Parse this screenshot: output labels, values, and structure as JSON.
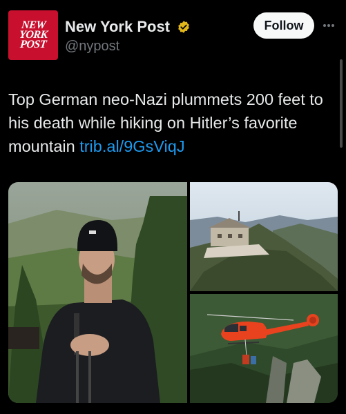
{
  "account": {
    "logo_lines": [
      "NEW",
      "YORK",
      "POST"
    ],
    "name": "New York Post",
    "handle": "@nypost",
    "verified": true,
    "verified_badge_color": "#e2b719"
  },
  "actions": {
    "follow_label": "Follow",
    "more_icon": "ellipsis-icon"
  },
  "tweet": {
    "text": "Top German neo-Nazi plummets 200 feet to his death while hiking on Hitler’s favorite mountain ",
    "link": "trib.al/9GsViqJ"
  },
  "media": {
    "photos": [
      "hiker-portrait-photo",
      "mountain-top-building-photo",
      "rescue-helicopter-photo"
    ]
  },
  "colors": {
    "background": "#000000",
    "text": "#e7e9ea",
    "secondary_text": "#71767b",
    "link": "#1d9bf0",
    "brand_red": "#c8102e",
    "helicopter": "#e8431e"
  }
}
